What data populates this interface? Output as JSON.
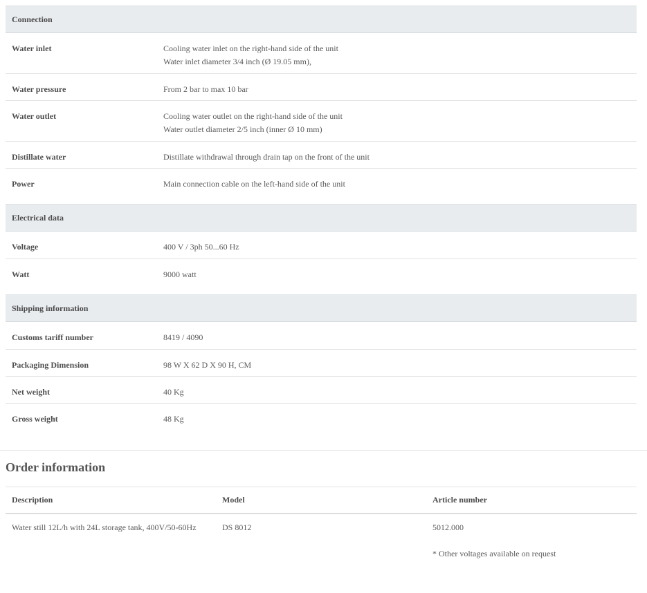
{
  "sections": [
    {
      "title": "Connection",
      "rows": [
        {
          "label": "Water inlet",
          "lines": [
            "Cooling water inlet on the right-hand side of the unit",
            "Water inlet diameter 3/4 inch (Ø 19.05 mm),"
          ]
        },
        {
          "label": "Water pressure",
          "lines": [
            "From 2 bar to max 10 bar"
          ]
        },
        {
          "label": "Water outlet",
          "lines": [
            "Cooling water outlet on the right-hand side of the unit",
            "Water outlet diameter 2/5 inch (inner Ø 10 mm)"
          ]
        },
        {
          "label": "Distillate water",
          "lines": [
            "Distillate withdrawal through drain tap on the front of the unit"
          ]
        },
        {
          "label": "Power",
          "lines": [
            "Main connection cable on the left-hand side of the unit"
          ]
        }
      ]
    },
    {
      "title": "Electrical data",
      "rows": [
        {
          "label": "Voltage",
          "lines": [
            "400 V / 3ph 50...60 Hz"
          ]
        },
        {
          "label": "Watt",
          "lines": [
            "9000 watt"
          ]
        }
      ]
    },
    {
      "title": "Shipping information",
      "rows": [
        {
          "label": "Customs tariff number",
          "lines": [
            "8419 / 4090"
          ]
        },
        {
          "label": "Packaging Dimension",
          "lines": [
            "98 W X 62 D X 90 H, CM"
          ]
        },
        {
          "label": "Net weight",
          "lines": [
            "40 Kg"
          ]
        },
        {
          "label": "Gross weight",
          "lines": [
            "48 Kg"
          ]
        }
      ]
    }
  ],
  "order": {
    "title": "Order information",
    "headers": {
      "description": "Description",
      "model": "Model",
      "article": "Article number"
    },
    "rows": [
      {
        "description": "Water still 12L/h with 24L storage tank, 400V/50-60Hz",
        "model": "DS 8012",
        "article": "5012.000"
      }
    ],
    "footnote": "* Other voltages available on request"
  }
}
